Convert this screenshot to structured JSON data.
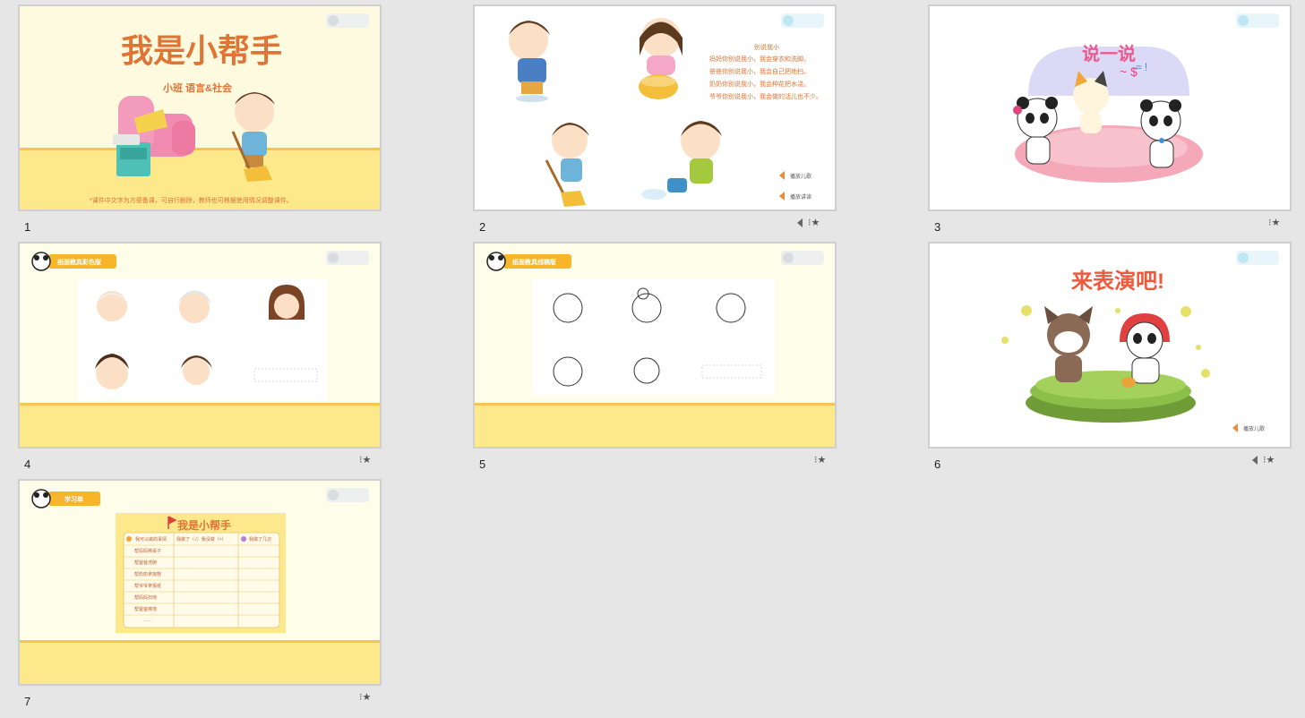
{
  "slides": [
    {
      "number": "1",
      "title": "我是小帮手",
      "subtitle": "小班  语言&社会",
      "note": "*课件中文字为方便备课，可自行删除，教师也可根据使用情况调整课件。",
      "has_audio": false
    },
    {
      "number": "2",
      "poem_title": "别说我小",
      "poem_lines": [
        "妈妈你别说我小，我会穿衣和洗脚。",
        "爸爸你别说我小，我会自己把地扫。",
        "奶奶你别说我小，我会种花把水浇。",
        "爷爷你别说我小，我会做的活儿也不少。"
      ],
      "audio_1": "播放儿歌",
      "audio_2": "播放讲读",
      "has_audio": true
    },
    {
      "number": "3",
      "title": "说一说",
      "has_audio": false
    },
    {
      "number": "4",
      "tag": "纸面教具彩色版",
      "has_audio": false
    },
    {
      "number": "5",
      "tag": "纸面教具线稿版",
      "has_audio": false
    },
    {
      "number": "6",
      "title": "来表演吧!",
      "audio_1": "播放儿歌",
      "has_audio": true
    },
    {
      "number": "7",
      "tag": "学习单",
      "sheet_title": "我是小帮手",
      "col_1": "我可以做的事情",
      "col_2": "我做了（√）我没做（×）",
      "col_3": "我做了几次",
      "rows": [
        "帮妈妈擦桌子",
        "帮爸爸洗碗",
        "帮奶奶拿拖鞋",
        "帮爷爷拿报纸",
        "帮妈妈扫地",
        "帮爸爸擦地",
        "……"
      ],
      "has_audio": false
    }
  ],
  "icons": {
    "audio": "speaker-icon",
    "animation": "star-icon"
  },
  "colors": {
    "title_orange": "#e07434",
    "tag_yellow": "#f7b52a",
    "floor_yellow": "#fde88a",
    "bg_cream": "#fefde9"
  }
}
